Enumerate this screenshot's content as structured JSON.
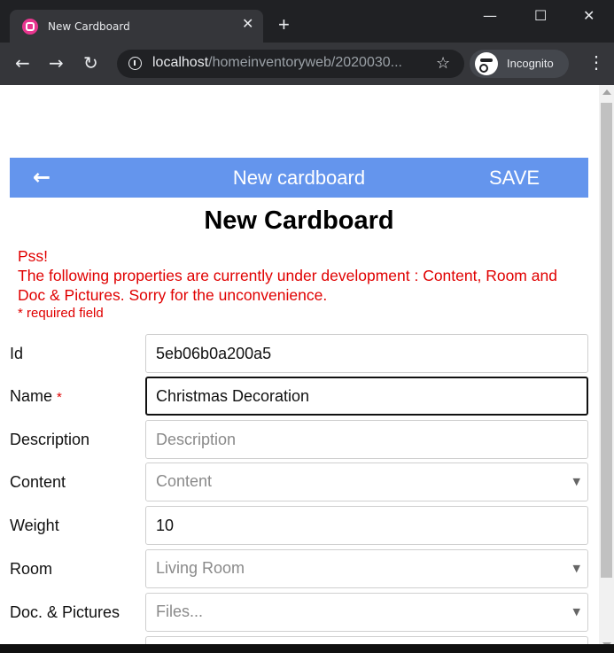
{
  "browser": {
    "tab_title": "New Cardboard",
    "tab_close": "✕",
    "new_tab": "+",
    "url_host": "localhost",
    "url_path": "/homeinventoryweb/2020030...",
    "incognito_label": "Incognito",
    "window_controls": {
      "minimize": "—",
      "maximize": "☐",
      "close": "✕"
    }
  },
  "appbar": {
    "title": "New cardboard",
    "save_label": "SAVE",
    "background": "#6495ed"
  },
  "page": {
    "heading": "New Cardboard",
    "notice_line1": "Pss!",
    "notice_line2": "The following properties are currently under development : Content, Room and Doc & Pictures. Sorry for the unconvenience.",
    "required_note": "* required field",
    "required_marker": "*"
  },
  "form": {
    "id": {
      "label": "Id",
      "value": "5eb06b0a200a5"
    },
    "name": {
      "label": "Name",
      "value": "Christmas Decoration"
    },
    "description": {
      "label": "Description",
      "placeholder": "Description"
    },
    "content": {
      "label": "Content",
      "value": "Content"
    },
    "weight": {
      "label": "Weight",
      "value": "10"
    },
    "room": {
      "label": "Room",
      "value": "Living Room"
    },
    "docs": {
      "label": "Doc. & Pictures",
      "value": "Files..."
    }
  },
  "colors": {
    "accent": "#6495ed",
    "warning": "#e00000"
  }
}
